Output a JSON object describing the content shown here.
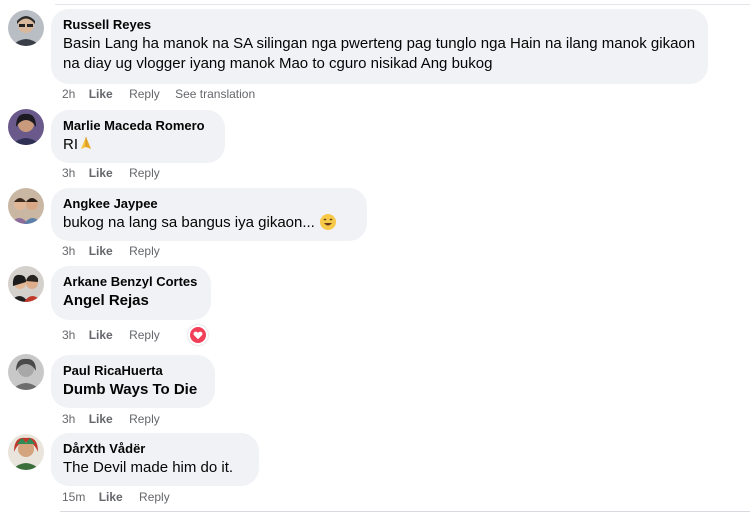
{
  "comments": [
    {
      "author": "Russell Reyes",
      "text": "Basin Lang ha manok na SA silingan nga pwerteng pag tunglo nga Hain na ilang manok gikaon na diay ug vlogger iyang manok Mao to cguro nisikad Ang bukog",
      "time": "2h",
      "like": "Like",
      "reply": "Reply",
      "see_translation": "See translation"
    },
    {
      "author": "Marlie Maceda Romero",
      "text": "RI",
      "emoji": "folded-hands-emoji",
      "time": "3h",
      "like": "Like",
      "reply": "Reply"
    },
    {
      "author": "Angkee Jaypee",
      "text": "bukog na lang sa bangus iya gikaon...",
      "emoji": "smiling-face-emoji",
      "time": "3h",
      "like": "Like",
      "reply": "Reply"
    },
    {
      "author": "Arkane Benzyl Cortes",
      "text": "Angel Rejas",
      "time": "3h",
      "like": "Like",
      "reply": "Reply",
      "reaction": "heart-reaction-icon"
    },
    {
      "author": "Paul RicaHuerta",
      "text": "Dumb Ways To Die",
      "time": "3h",
      "like": "Like",
      "reply": "Reply"
    },
    {
      "author": "DårXth Vådër",
      "text": "The Devil made him do it.",
      "time": "15m",
      "like": "Like",
      "reply": "Reply"
    }
  ],
  "colors": {
    "bubble": "#f0f2f5",
    "meta_text": "#65676b",
    "text": "#050505",
    "heart": "#f33e58"
  }
}
